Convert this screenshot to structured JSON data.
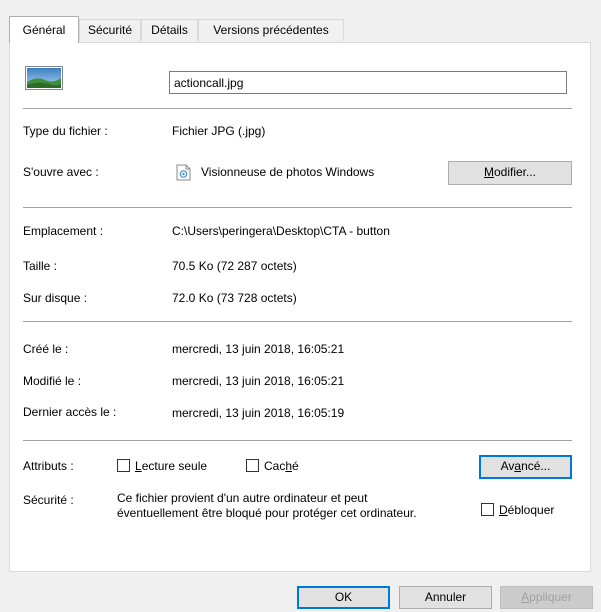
{
  "tabs": [
    {
      "label": "Général",
      "active": true
    },
    {
      "label": "Sécurité"
    },
    {
      "label": "Détails"
    },
    {
      "label": "Versions précédentes"
    }
  ],
  "file": {
    "name": "actioncall.jpg"
  },
  "type": {
    "label": "Type du fichier :",
    "value": "Fichier JPG (.jpg)"
  },
  "opens_with": {
    "label": "S'ouvre avec :",
    "value": "Visionneuse de photos Windows",
    "button_pre": "",
    "button_u": "M",
    "button_post": "odifier..."
  },
  "location": {
    "label": "Emplacement :",
    "value": "C:\\Users\\peringera\\Desktop\\CTA - button"
  },
  "size": {
    "label": "Taille :",
    "value": "70.5 Ko (72 287 octets)"
  },
  "disk_size": {
    "label": "Sur disque :",
    "value": "72.0 Ko (73 728 octets)"
  },
  "created": {
    "label": "Créé le :",
    "value": "mercredi, 13 juin 2018, 16:05:21"
  },
  "modified": {
    "label": "Modifié le :",
    "value": "mercredi, 13 juin 2018, 16:05:21"
  },
  "accessed": {
    "label": "Dernier accès le :",
    "value": "mercredi, 13 juin 2018, 16:05:19"
  },
  "attributes": {
    "label": "Attributs :",
    "readonly_u": "L",
    "readonly_post": "ecture seule",
    "hidden_pre": "Cac",
    "hidden_u": "h",
    "hidden_post": "é",
    "advanced_pre": "Av",
    "advanced_u": "a",
    "advanced_post": "ncé..."
  },
  "security": {
    "label": "Sécurité :",
    "line1": "Ce fichier provient d'un autre ordinateur et peut",
    "line2": "éventuellement être bloqué pour protéger cet ordinateur.",
    "unblock_u": "D",
    "unblock_post": "ébloquer"
  },
  "footer": {
    "ok": "OK",
    "cancel": "Annuler",
    "apply_u": "A",
    "apply_post": "ppliquer"
  },
  "colors": {
    "accent": "#0078d7",
    "panel": "#ffffff",
    "window": "#f0f0f0"
  }
}
